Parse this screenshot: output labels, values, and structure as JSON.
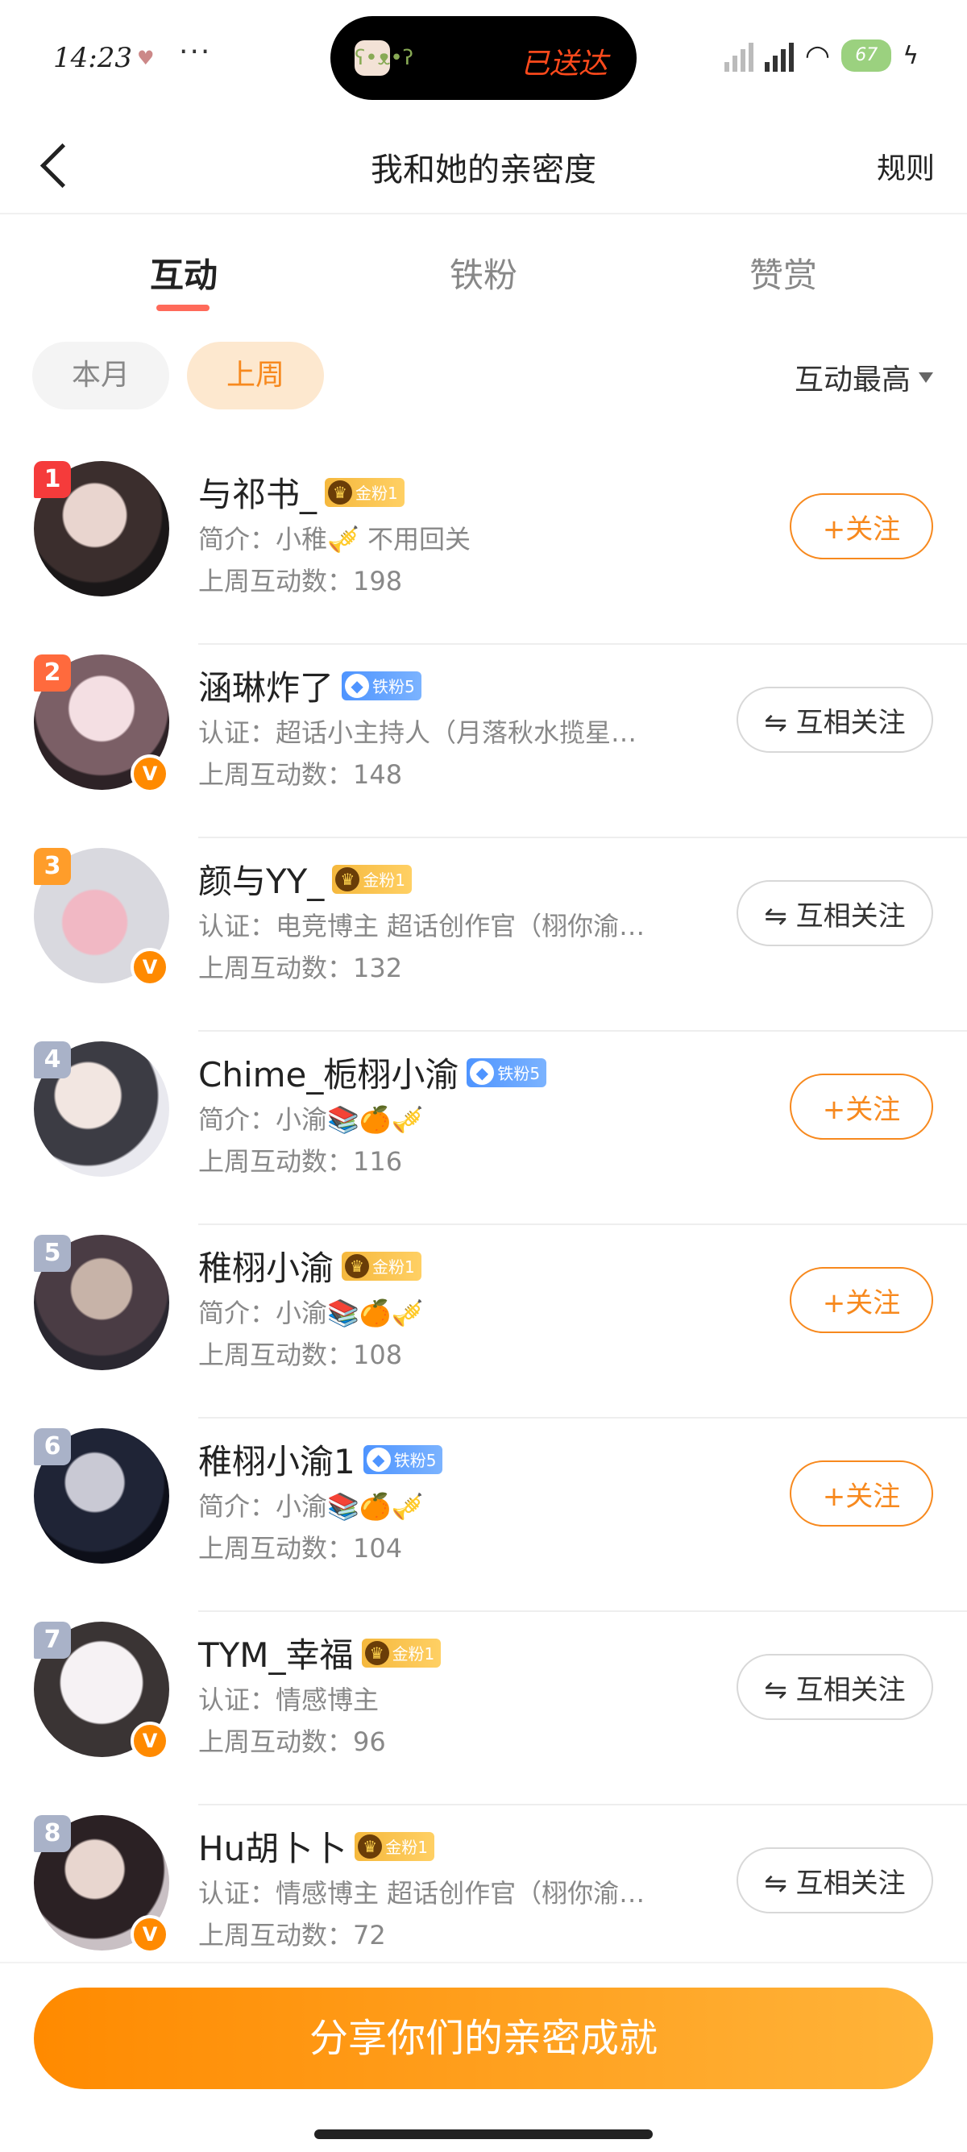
{
  "status_bar": {
    "time": "14:23",
    "dots": "···",
    "pill_text": "已送达",
    "network": "5G",
    "battery": "67"
  },
  "navbar": {
    "title": "我和她的亲密度",
    "rules": "规则"
  },
  "tabs": [
    {
      "label": "互动",
      "active": true
    },
    {
      "label": "铁粉",
      "active": false
    },
    {
      "label": "赞赏",
      "active": false
    }
  ],
  "filters": {
    "month": "本月",
    "week": "上周",
    "sort": "互动最高"
  },
  "colors": {
    "accent": "#f7891e",
    "tab_underline": "#ff6a5a",
    "rank1": "#f53b3b",
    "rank2": "#ff6a3d",
    "rank3": "#ff9d2a",
    "rank_other": "#a9b2c8"
  },
  "users": [
    {
      "rank": "1",
      "name": "与祁书_",
      "badge_type": "gold",
      "badge_text": "金粉1",
      "desc": "简介：小稚🎺 不用回关",
      "count": "上周互动数：198",
      "action": "follow",
      "verified": false
    },
    {
      "rank": "2",
      "name": "涵琳炸了",
      "badge_type": "blue",
      "badge_text": "铁粉5",
      "desc": "认证：超话小主持人（月落秋水揽星…",
      "count": "上周互动数：148",
      "action": "mutual",
      "verified": true
    },
    {
      "rank": "3",
      "name": "颜与YY_",
      "badge_type": "gold",
      "badge_text": "金粉1",
      "desc": "认证：电竞博主 超话创作官（栩你渝…",
      "count": "上周互动数：132",
      "action": "mutual",
      "verified": true
    },
    {
      "rank": "4",
      "name": "Chime_栀栩小渝",
      "badge_type": "blue",
      "badge_text": "铁粉5",
      "desc": "简介：小渝📚🍊🎺",
      "count": "上周互动数：116",
      "action": "follow",
      "verified": false
    },
    {
      "rank": "5",
      "name": "稚栩小渝",
      "badge_type": "gold",
      "badge_text": "金粉1",
      "desc": "简介：小渝📚🍊🎺",
      "count": "上周互动数：108",
      "action": "follow",
      "verified": false
    },
    {
      "rank": "6",
      "name": "稚栩小渝1",
      "badge_type": "blue",
      "badge_text": "铁粉5",
      "desc": "简介：小渝📚🍊🎺",
      "count": "上周互动数：104",
      "action": "follow",
      "verified": false
    },
    {
      "rank": "7",
      "name": "TYM_幸福",
      "badge_type": "gold",
      "badge_text": "金粉1",
      "desc": "认证：情感博主",
      "count": "上周互动数：96",
      "action": "mutual",
      "verified": true
    },
    {
      "rank": "8",
      "name": "Hu胡卜卜",
      "badge_type": "gold",
      "badge_text": "金粉1",
      "desc": "认证：情感博主 超话创作官（栩你渝…",
      "count": "上周互动数：72",
      "action": "mutual",
      "verified": true
    }
  ],
  "buttons": {
    "follow": "+关注",
    "mutual": "⇋ 互相关注"
  },
  "share_button": "分享你们的亲密成就"
}
